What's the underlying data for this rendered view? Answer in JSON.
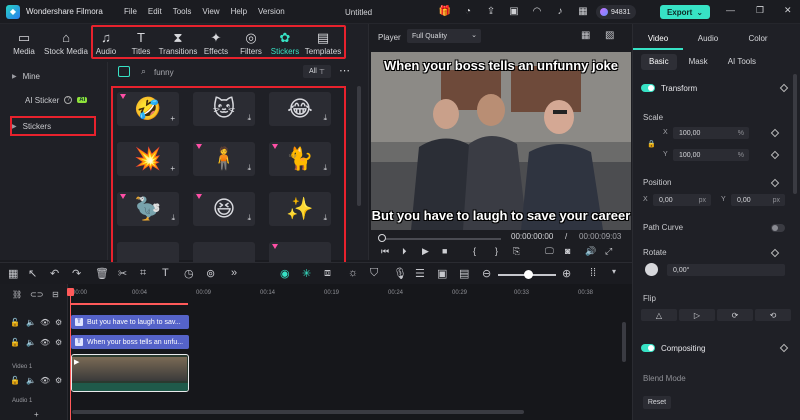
{
  "app": {
    "name": "Wondershare Filmora",
    "menu": [
      "File",
      "Edit",
      "Tools",
      "View",
      "Help",
      "Version"
    ],
    "project_name": "Untitled",
    "credits": "94831",
    "export_label": "Export"
  },
  "library": {
    "tabs": [
      {
        "label": "Media",
        "icon": "media-icon"
      },
      {
        "label": "Stock Media",
        "icon": "stock-media-icon"
      },
      {
        "label": "Audio",
        "icon": "music-note-icon"
      },
      {
        "label": "Titles",
        "icon": "titles-icon"
      },
      {
        "label": "Transitions",
        "icon": "transitions-icon"
      },
      {
        "label": "Effects",
        "icon": "effects-icon"
      },
      {
        "label": "Filters",
        "icon": "filters-icon"
      },
      {
        "label": "Stickers",
        "icon": "stickers-icon"
      },
      {
        "label": "Templates",
        "icon": "templates-icon"
      }
    ],
    "active_tab": "Stickers",
    "sidebar": {
      "mine": "Mine",
      "ai_sticker": "AI Sticker",
      "ai_badge": "AI",
      "stickers": "Stickers"
    },
    "search": {
      "value": "funny",
      "filter_label": "All"
    },
    "stickers": [
      {
        "name": "laughing-emoji-sticker",
        "emoji": "🤣"
      },
      {
        "name": "cat-meme-sticker",
        "emoji": "🐱"
      },
      {
        "name": "tears-of-joy-sticker",
        "emoji": "😂"
      },
      {
        "name": "oops-text-sticker",
        "emoji": "💥"
      },
      {
        "name": "dark-figure-sticker",
        "emoji": "🧍"
      },
      {
        "name": "cat-sticker",
        "emoji": "🐈"
      },
      {
        "name": "ostrich-sticker",
        "emoji": "🦤"
      },
      {
        "name": "grinning-emoji-sticker",
        "emoji": "😆"
      },
      {
        "name": "sparkle-line-sticker",
        "emoji": "✨"
      }
    ],
    "accent": "#37e2c5",
    "highlight": "#e8222d"
  },
  "player": {
    "label": "Player",
    "quality": "Full Quality",
    "caption_top": "When your boss tells an unfunny joke",
    "caption_bottom": "But you have to laugh to save your career",
    "time_current": "00:00:00:00",
    "time_separator": "/",
    "time_total": "00:00:09:03"
  },
  "properties": {
    "tabs": [
      "Video",
      "Audio",
      "Color"
    ],
    "subtabs": [
      "Basic",
      "Mask",
      "AI Tools"
    ],
    "transform": "Transform",
    "scale_label": "Scale",
    "scale_x": "100,00",
    "scale_y": "100,00",
    "scale_unit": "%",
    "position_label": "Position",
    "pos_x": "0,00",
    "pos_y": "0,00",
    "pos_unit": "px",
    "path_curve": "Path Curve",
    "rotate_label": "Rotate",
    "rotate_value": "0,00°",
    "flip_label": "Flip",
    "compositing": "Compositing",
    "blend_mode": "Blend Mode",
    "reset_label": "Reset",
    "axis_x": "X",
    "axis_y": "Y"
  },
  "timeline": {
    "ruler": [
      "00:00",
      "00:04",
      "00:09",
      "00:14",
      "00:19",
      "00:24",
      "00:29",
      "00:33",
      "00:38"
    ],
    "clips": {
      "text1": "But you have to laugh to sav...",
      "text2": "When your boss tells an unfu..."
    },
    "video_track": "Video 1",
    "audio_track": "Audio 1"
  }
}
